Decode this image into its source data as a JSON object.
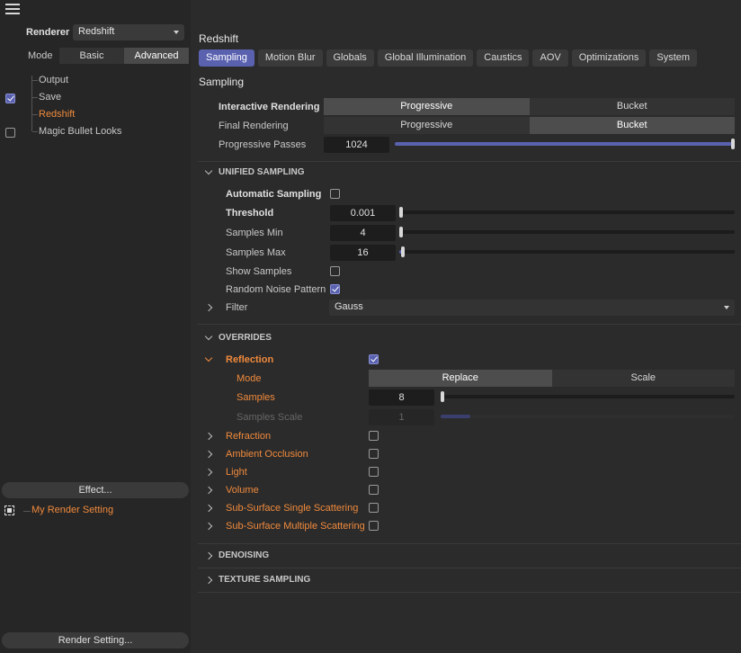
{
  "left": {
    "renderer_label": "Renderer",
    "renderer_value": "Redshift",
    "mode_label": "Mode",
    "mode_options": [
      "Basic",
      "Advanced"
    ],
    "mode_active": "Advanced",
    "tree": [
      {
        "label": "Output",
        "checkbox": null,
        "selected": false
      },
      {
        "label": "Save",
        "checkbox": true,
        "selected": false
      },
      {
        "label": "Redshift",
        "checkbox": null,
        "selected": true
      },
      {
        "label": "Magic Bullet Looks",
        "checkbox": false,
        "selected": false
      }
    ],
    "effect_button": "Effect...",
    "render_setting_name": "My Render Setting",
    "render_setting_button": "Render Setting..."
  },
  "right": {
    "title": "Redshift",
    "tabs": [
      "Sampling",
      "Motion Blur",
      "Globals",
      "Global Illumination",
      "Caustics",
      "AOV",
      "Optimizations",
      "System"
    ],
    "active_tab": "Sampling",
    "section_title": "Sampling",
    "interactive_rendering": {
      "label": "Interactive Rendering",
      "options": [
        "Progressive",
        "Bucket"
      ],
      "active": "Progressive"
    },
    "final_rendering": {
      "label": "Final Rendering",
      "options": [
        "Progressive",
        "Bucket"
      ],
      "active": "Bucket"
    },
    "progressive_passes": {
      "label": "Progressive Passes",
      "value": "1024",
      "fraction": 1.0
    },
    "unified": {
      "title": "UNIFIED SAMPLING",
      "automatic_sampling": {
        "label": "Automatic Sampling",
        "checked": false
      },
      "threshold": {
        "label": "Threshold",
        "value": "0.001",
        "fraction": 0.0
      },
      "samples_min": {
        "label": "Samples Min",
        "value": "4",
        "fraction": 0.0
      },
      "samples_max": {
        "label": "Samples Max",
        "value": "16",
        "fraction": 0.01
      },
      "show_samples": {
        "label": "Show Samples",
        "checked": false
      },
      "random_noise": {
        "label": "Random Noise Pattern",
        "checked": true
      },
      "filter": {
        "label": "Filter",
        "value": "Gauss"
      }
    },
    "overrides": {
      "title": "OVERRIDES",
      "reflection": {
        "label": "Reflection",
        "checked": true
      },
      "mode": {
        "label": "Mode",
        "options": [
          "Replace",
          "Scale"
        ],
        "active": "Replace"
      },
      "samples": {
        "label": "Samples",
        "value": "8",
        "fraction": 0.0
      },
      "samples_scale": {
        "label": "Samples Scale",
        "value": "1",
        "fraction": 0.1
      },
      "items": [
        {
          "label": "Refraction",
          "checked": false
        },
        {
          "label": "Ambient Occlusion",
          "checked": false
        },
        {
          "label": "Light",
          "checked": false
        },
        {
          "label": "Volume",
          "checked": false
        },
        {
          "label": "Sub-Surface Single Scattering",
          "checked": false
        },
        {
          "label": "Sub-Surface Multiple Scattering",
          "checked": false
        }
      ]
    },
    "denoising_title": "DENOISING",
    "texture_sampling_title": "TEXTURE SAMPLING"
  },
  "colors": {
    "accent": "#5a62b0",
    "highlight": "#f08a3c"
  }
}
